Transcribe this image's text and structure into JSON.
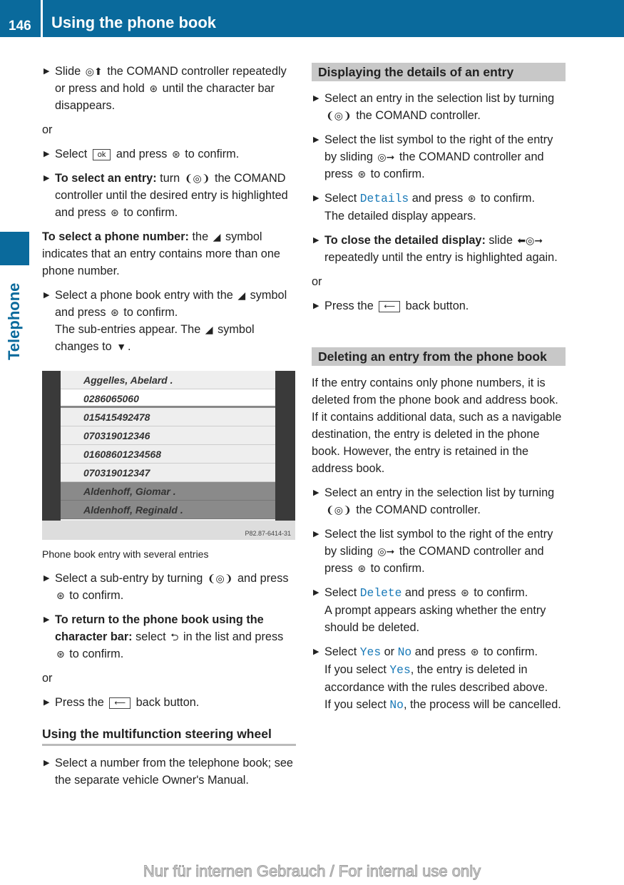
{
  "header": {
    "page_number": "146",
    "title": "Using the phone book"
  },
  "side_tab": {
    "label": "Telephone"
  },
  "left": [
    {
      "k": "b",
      "r": [
        {
          "t": "Slide "
        },
        {
          "i": "slide-up-icon"
        },
        {
          "t": " the COMAND controller repeatedly or press and hold "
        },
        {
          "i": "press-icon"
        },
        {
          "t": " until the character bar disappears."
        }
      ]
    },
    {
      "k": "p",
      "r": [
        {
          "t": "or"
        }
      ]
    },
    {
      "k": "b",
      "r": [
        {
          "t": "Select "
        },
        {
          "box": "ok"
        },
        {
          "t": " and press "
        },
        {
          "i": "press-icon"
        },
        {
          "t": " to confirm."
        }
      ]
    },
    {
      "k": "b",
      "r": [
        {
          "t": "To select an entry:",
          "b": 1
        },
        {
          "t": " turn "
        },
        {
          "i": "turn-icon"
        },
        {
          "t": " the COMAND controller until the desired entry is highlighted and press "
        },
        {
          "i": "press-icon"
        },
        {
          "t": " to confirm."
        }
      ]
    },
    {
      "k": "p",
      "r": [
        {
          "t": "To select a phone number:",
          "b": 1
        },
        {
          "t": " the "
        },
        {
          "i": "corner-symbol-icon"
        },
        {
          "t": " symbol indicates that an entry contains more than one phone number."
        }
      ]
    },
    {
      "k": "b",
      "r": [
        {
          "t": "Select a phone book entry with the "
        },
        {
          "i": "corner-symbol-icon"
        },
        {
          "t": " symbol and press "
        },
        {
          "i": "press-icon"
        },
        {
          "t": " to confirm."
        },
        {
          "br": 1
        },
        {
          "t": "The sub-entries appear. The "
        },
        {
          "i": "corner-symbol-icon"
        },
        {
          "t": " symbol changes to "
        },
        {
          "i": "down-triangle-icon"
        },
        {
          "t": "."
        }
      ]
    }
  ],
  "screenshot": {
    "rows": [
      {
        "text": "Aggelles, Abelard .",
        "style": ""
      },
      {
        "text": "0286065060",
        "style": "sel"
      },
      {
        "text": "015415492478",
        "style": ""
      },
      {
        "text": "070319012346",
        "style": ""
      },
      {
        "text": "01608601234568",
        "style": ""
      },
      {
        "text": "070319012347",
        "style": ""
      },
      {
        "text": "Aldenhoff, Giomar .",
        "style": "dim"
      },
      {
        "text": "Aldenhoff, Reginald .",
        "style": "dim"
      }
    ],
    "code": "P82.87-6414-31",
    "caption": "Phone book entry with several entries"
  },
  "left2": [
    {
      "k": "b",
      "r": [
        {
          "t": "Select a sub-entry by turning "
        },
        {
          "i": "turn-icon"
        },
        {
          "t": " and press "
        },
        {
          "i": "press-icon"
        },
        {
          "t": " to confirm."
        }
      ]
    },
    {
      "k": "b",
      "r": [
        {
          "t": "To return to the phone book using the character bar:",
          "b": 1
        },
        {
          "t": " select "
        },
        {
          "i": "return-list-icon"
        },
        {
          "t": " in the list and press "
        },
        {
          "i": "press-icon"
        },
        {
          "t": " to confirm."
        }
      ]
    },
    {
      "k": "p",
      "r": [
        {
          "t": "or"
        }
      ]
    },
    {
      "k": "b",
      "r": [
        {
          "t": "Press the "
        },
        {
          "i": "back-button-icon"
        },
        {
          "t": " back button."
        }
      ]
    },
    {
      "k": "h3",
      "r": [
        {
          "t": "Using the multifunction steering wheel"
        }
      ]
    },
    {
      "k": "b",
      "r": [
        {
          "t": "Select a number from the telephone book; see the separate vehicle Owner's Manual."
        }
      ]
    }
  ],
  "right": [
    {
      "k": "sec",
      "r": [
        {
          "t": "Displaying the details of an entry"
        }
      ]
    },
    {
      "k": "b",
      "r": [
        {
          "t": "Select an entry in the selection list by turning "
        },
        {
          "i": "turn-icon"
        },
        {
          "t": " the COMAND controller."
        }
      ]
    },
    {
      "k": "b",
      "r": [
        {
          "t": "Select the list symbol to the right of the entry by sliding "
        },
        {
          "i": "slide-right-icon"
        },
        {
          "t": " the COMAND controller and press "
        },
        {
          "i": "press-icon"
        },
        {
          "t": " to confirm."
        }
      ]
    },
    {
      "k": "b",
      "r": [
        {
          "t": "Select "
        },
        {
          "t": "Details",
          "m": 1
        },
        {
          "t": " and press "
        },
        {
          "i": "press-icon"
        },
        {
          "t": " to confirm."
        },
        {
          "br": 1
        },
        {
          "t": "The detailed display appears."
        }
      ]
    },
    {
      "k": "b",
      "r": [
        {
          "t": "To close the detailed display:",
          "b": 1
        },
        {
          "t": " slide "
        },
        {
          "i": "slide-left-right-icon"
        },
        {
          "t": " repeatedly until the entry is highlighted again."
        }
      ]
    },
    {
      "k": "p",
      "r": [
        {
          "t": "or"
        }
      ]
    },
    {
      "k": "b",
      "r": [
        {
          "t": "Press the "
        },
        {
          "i": "back-button-icon"
        },
        {
          "t": " back button."
        }
      ]
    },
    {
      "k": "sec2",
      "r": [
        {
          "t": "Deleting an entry from the phone book"
        }
      ]
    },
    {
      "k": "p",
      "r": [
        {
          "t": "If the entry contains only phone numbers, it is deleted from the phone book and address book."
        },
        {
          "br": 1
        },
        {
          "t": "If it contains additional data, such as a navigable destination, the entry is deleted in the phone book. However, the entry is retained in the address book."
        }
      ]
    },
    {
      "k": "b",
      "r": [
        {
          "t": "Select an entry in the selection list by turning "
        },
        {
          "i": "turn-icon"
        },
        {
          "t": " the COMAND controller."
        }
      ]
    },
    {
      "k": "b",
      "r": [
        {
          "t": "Select the list symbol to the right of the entry by sliding "
        },
        {
          "i": "slide-right-icon"
        },
        {
          "t": " the COMAND controller and press "
        },
        {
          "i": "press-icon"
        },
        {
          "t": " to confirm."
        }
      ]
    },
    {
      "k": "b",
      "r": [
        {
          "t": "Select "
        },
        {
          "t": "Delete",
          "m": 1
        },
        {
          "t": " and press "
        },
        {
          "i": "press-icon"
        },
        {
          "t": " to confirm."
        },
        {
          "br": 1
        },
        {
          "t": "A prompt appears asking whether the entry should be deleted."
        }
      ]
    },
    {
      "k": "b",
      "r": [
        {
          "t": "Select "
        },
        {
          "t": "Yes",
          "m": 1
        },
        {
          "t": " or "
        },
        {
          "t": "No",
          "m": 1
        },
        {
          "t": " and press "
        },
        {
          "i": "press-icon"
        },
        {
          "t": " to confirm."
        },
        {
          "br": 1
        },
        {
          "t": "If you select "
        },
        {
          "t": "Yes",
          "m": 1
        },
        {
          "t": ", the entry is deleted in accordance with the rules described above."
        },
        {
          "br": 1
        },
        {
          "t": "If you select "
        },
        {
          "t": "No",
          "m": 1
        },
        {
          "t": ", the process will be cancelled."
        }
      ]
    }
  ],
  "watermark": "Nur für internen Gebrauch / For internal use only",
  "colors": {
    "brand_blue": "#0a6a9c",
    "highlight_mono": "#1a7ab8",
    "section_bg": "#c8c8c8"
  }
}
